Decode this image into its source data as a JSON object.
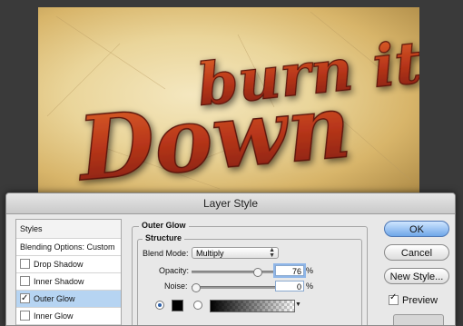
{
  "canvas": {
    "artwork_text_line1": "burn it",
    "artwork_text_line2": "Down"
  },
  "dialog": {
    "title": "Layer Style",
    "styles_list": [
      {
        "label": "Styles",
        "checked": null
      },
      {
        "label": "Blending Options: Custom",
        "checked": null
      },
      {
        "label": "Drop Shadow",
        "checked": false
      },
      {
        "label": "Inner Shadow",
        "checked": false
      },
      {
        "label": "Outer Glow",
        "checked": true
      },
      {
        "label": "Inner Glow",
        "checked": false
      }
    ],
    "section_title": "Outer Glow",
    "subsection_title": "Structure",
    "blend_mode_label": "Blend Mode:",
    "blend_mode_value": "Multiply",
    "opacity_label": "Opacity:",
    "opacity_value": "76",
    "opacity_fraction": 0.76,
    "noise_label": "Noise:",
    "noise_value": "0",
    "noise_fraction": 0.0,
    "percent": "%",
    "glow_color": "#000000",
    "buttons": {
      "ok": "OK",
      "cancel": "Cancel",
      "new_style": "New Style..."
    },
    "preview_label": "Preview",
    "preview_checked": true
  },
  "colors": {
    "accent": "#6fa7e8",
    "selection": "#b6d4f2"
  }
}
